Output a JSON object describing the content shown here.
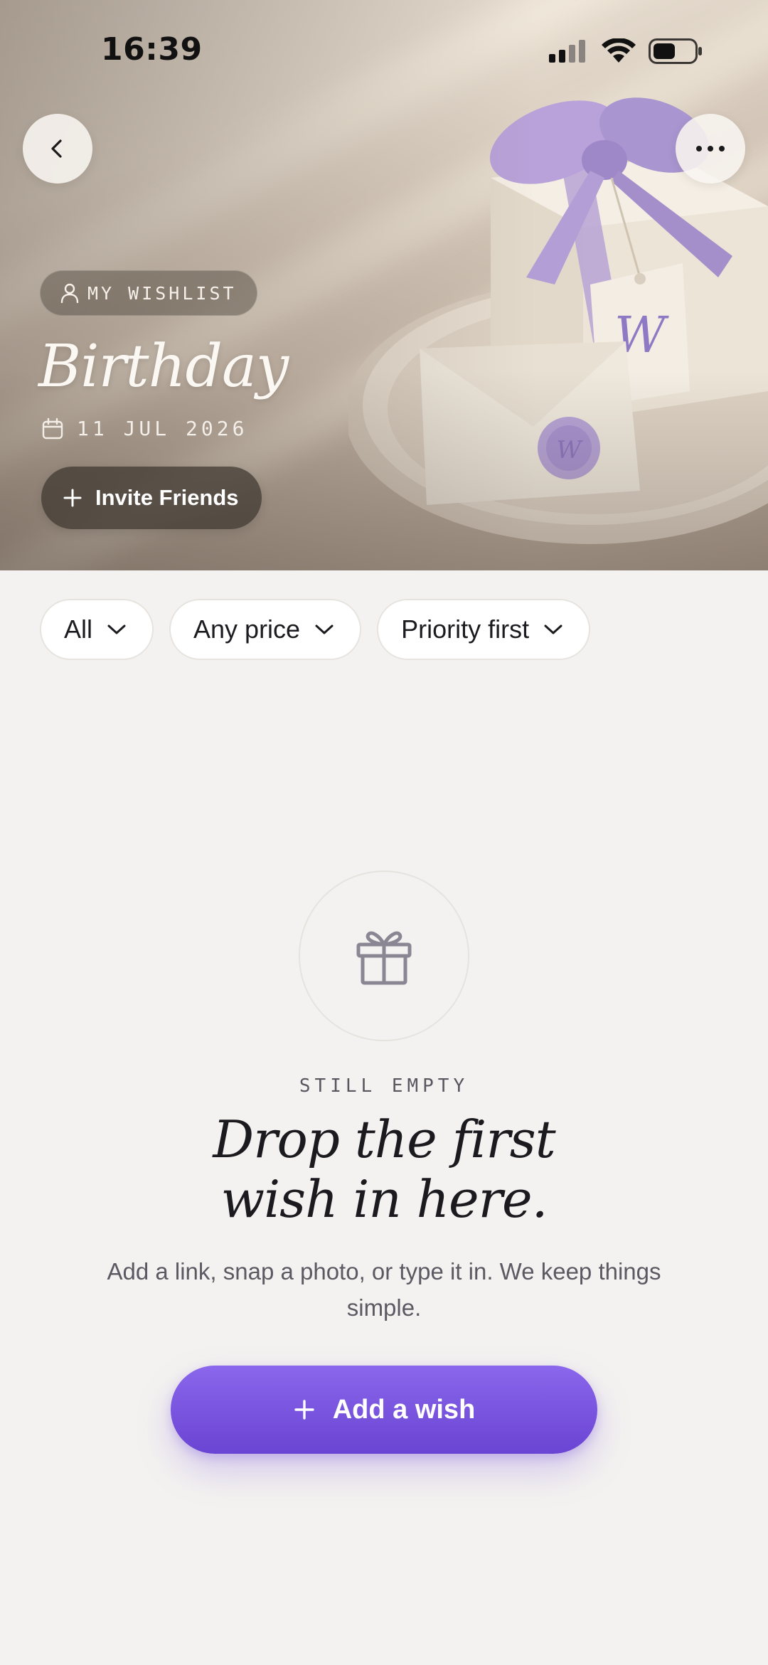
{
  "status_bar": {
    "time": "16:39",
    "icons": [
      "cellular-signal-icon",
      "wifi-icon",
      "battery-icon"
    ]
  },
  "header": {
    "back_icon": "chevron-left-icon",
    "more_icon": "more-horizontal-icon"
  },
  "hero": {
    "chip_icon": "person-icon",
    "chip_label": "MY WISHLIST",
    "title": "Birthday",
    "date_icon": "calendar-icon",
    "date": "11 JUL 2026",
    "invite_label": "Invite Friends",
    "image": "gift-box-with-lavender-ribbon"
  },
  "filters": [
    {
      "label": "All"
    },
    {
      "label": "Any price"
    },
    {
      "label": "Priority first"
    }
  ],
  "empty_state": {
    "icon": "gift-icon",
    "eyebrow": "STILL EMPTY",
    "headline_line1": "Drop the first",
    "headline_line2": "wish in here.",
    "subtext": "Add a link, snap a photo, or type it in. We keep things simple.",
    "button_label": "Add a wish"
  },
  "colors": {
    "accent": "#7250DC",
    "background": "#F4F2F0",
    "text_primary": "#1A1A1F",
    "text_secondary": "#5C5962"
  }
}
